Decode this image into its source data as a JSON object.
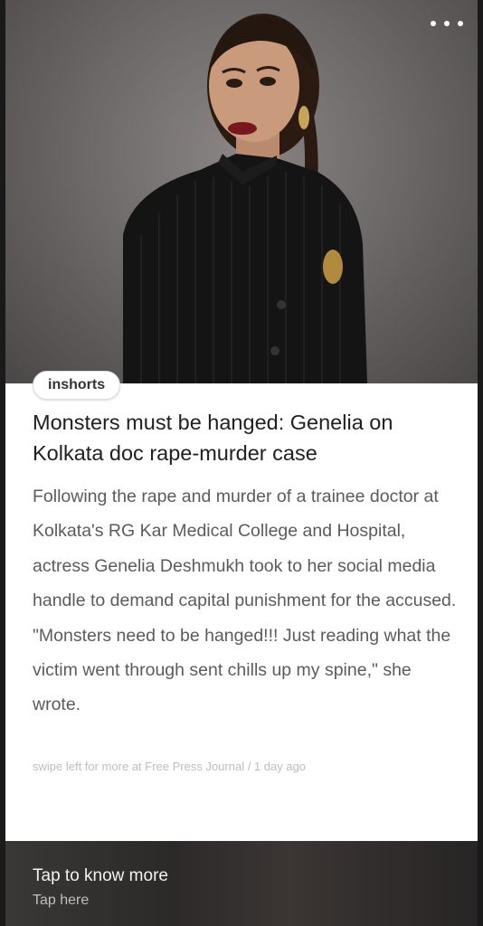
{
  "header": {
    "menu_icon": "more-horizontal-icon"
  },
  "article": {
    "brand": "inshorts",
    "headline": "Monsters must be hanged: Genelia on Kolkata doc rape-murder case",
    "body": "Following the rape and murder of a trainee doctor at Kolkata's RG Kar Medical College and Hospital, actress Genelia Deshmukh took to her social media handle to demand capital punishment for the accused. \"Monsters need to be hanged!!! Just reading what the victim went through sent chills up my spine,\" she wrote.",
    "meta": "swipe left for more at Free Press Journal / 1 day ago"
  },
  "footer": {
    "title": "Tap to know more",
    "subtitle": "Tap here"
  }
}
